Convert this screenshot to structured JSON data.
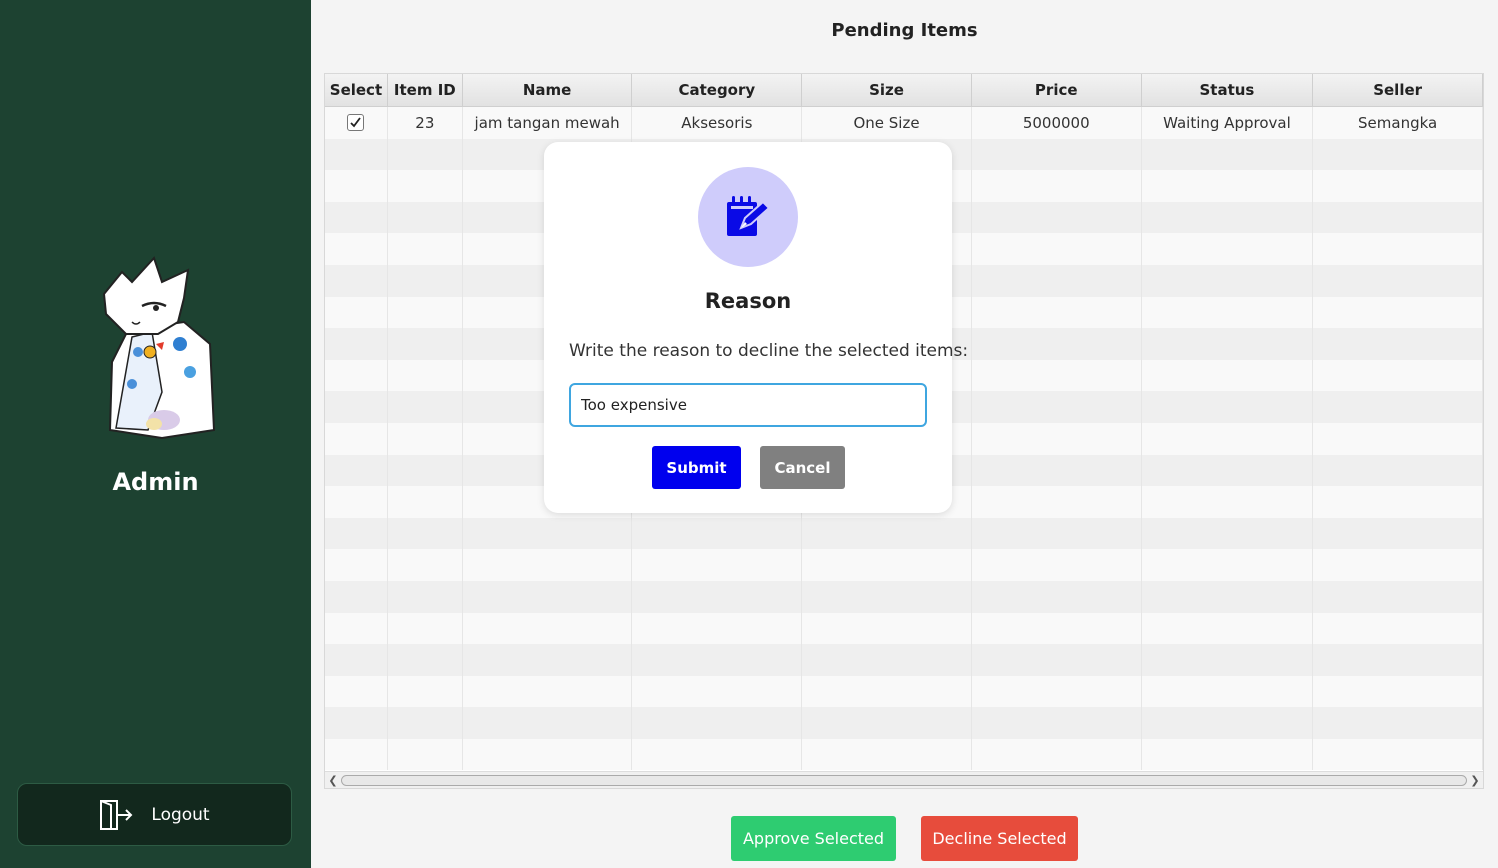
{
  "sidebar": {
    "user_name": "Admin",
    "logout_label": "Logout"
  },
  "main": {
    "title": "Pending Items",
    "columns": [
      "Select",
      "Item ID",
      "Name",
      "Category",
      "Size",
      "Price",
      "Status",
      "Seller"
    ],
    "rows": [
      {
        "selected": true,
        "id": "23",
        "name": "jam tangan mewah",
        "category": "Aksesoris",
        "size": "One Size",
        "price": "5000000",
        "status": "Waiting Approval",
        "seller": "Semangka"
      }
    ],
    "approve_label": "Approve Selected",
    "decline_label": "Decline Selected"
  },
  "modal": {
    "icon": "notepad-edit-icon",
    "title": "Reason",
    "message": "Write the reason to decline the selected items:",
    "input_value": "Too expensive",
    "submit_label": "Submit",
    "cancel_label": "Cancel"
  },
  "colors": {
    "sidebar_bg": "#1d4231",
    "approve": "#2ecc71",
    "decline": "#e74c3c",
    "submit": "#0000ee",
    "cancel": "#808080",
    "icon_bg": "#cfccfb"
  }
}
